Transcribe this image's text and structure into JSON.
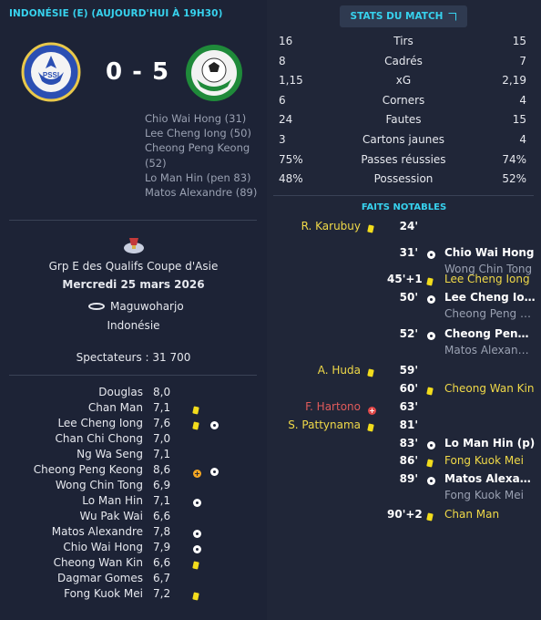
{
  "header": {
    "title": "INDONÉSIE (E) (AUJOURD'HUI À 19H30)"
  },
  "match": {
    "score": "0 - 5",
    "scorers": [
      "Chio Wai Hong (31)",
      "Lee Cheng Iong (50)",
      "Cheong Peng Keong (52)",
      "Lo Man Hin (pen 83)",
      "Matos Alexandre (89)"
    ],
    "competition": "Grp E des Qualifs Coupe d'Asie",
    "date": "Mercredi 25 mars 2026",
    "venue": "Maguwoharjo",
    "country": "Indonésie",
    "attendance": "Spectateurs : 31 700"
  },
  "crests": {
    "home_text": "PSSI",
    "away_text": ""
  },
  "ratings": [
    {
      "name": "Douglas",
      "rating": "8,0",
      "icons": []
    },
    {
      "name": "Chan Man",
      "rating": "7,1",
      "icons": [
        "yellow-card"
      ]
    },
    {
      "name": "Lee Cheng Iong",
      "rating": "7,6",
      "icons": [
        "yellow-card",
        "goal"
      ]
    },
    {
      "name": "Chan Chi Chong",
      "rating": "7,0",
      "icons": []
    },
    {
      "name": "Ng Wa Seng",
      "rating": "7,1",
      "icons": []
    },
    {
      "name": "Cheong Peng Keong",
      "rating": "8,6",
      "icons": [
        "sub",
        "goal"
      ]
    },
    {
      "name": "Wong Chin Tong",
      "rating": "6,9",
      "icons": []
    },
    {
      "name": "Lo Man Hin",
      "rating": "7,1",
      "icons": [
        "goal"
      ]
    },
    {
      "name": "Wu Pak Wai",
      "rating": "6,6",
      "icons": []
    },
    {
      "name": "Matos Alexandre",
      "rating": "7,8",
      "icons": [
        "goal"
      ]
    },
    {
      "name": "Chio Wai Hong",
      "rating": "7,9",
      "icons": [
        "goal"
      ]
    },
    {
      "name": "Cheong Wan Kin",
      "rating": "6,6",
      "icons": [
        "yellow-card"
      ]
    },
    {
      "name": "Dagmar Gomes",
      "rating": "6,7",
      "icons": []
    },
    {
      "name": "Fong Kuok Mei",
      "rating": "7,2",
      "icons": [
        "yellow-card"
      ]
    }
  ],
  "stats_button": "STATS DU MATCH",
  "stats": [
    {
      "home": "16",
      "name": "Tirs",
      "away": "15"
    },
    {
      "home": "8",
      "name": "Cadrés",
      "away": "7"
    },
    {
      "home": "1,15",
      "name": "xG",
      "away": "2,19"
    },
    {
      "home": "6",
      "name": "Corners",
      "away": "4"
    },
    {
      "home": "24",
      "name": "Fautes",
      "away": "15"
    },
    {
      "home": "3",
      "name": "Cartons jaunes",
      "away": "4"
    },
    {
      "home": "75%",
      "name": "Passes réussies",
      "away": "74%"
    },
    {
      "home": "48%",
      "name": "Possession",
      "away": "52%"
    }
  ],
  "faits_title": "FAITS NOTABLES",
  "events": [
    {
      "min": "24'",
      "home": "R. Karubuy",
      "home_icon": "yellow-card"
    },
    {
      "min": "31'",
      "away": "Chio Wai Hong",
      "away_sub": "Wong Chin Tong",
      "away_icon": "goal"
    },
    {
      "min": "45'+1",
      "away": "Lee Cheng Iong",
      "away_icon": "yellow-card",
      "away_yellow": true
    },
    {
      "min": "50'",
      "away": "Lee Cheng Iong",
      "away_sub": "Cheong Peng Keong",
      "away_icon": "goal"
    },
    {
      "min": "52'",
      "away": "Cheong Peng Keong",
      "away_sub": "Matos Alexandre",
      "away_icon": "goal"
    },
    {
      "min": "59'",
      "home": "A. Huda",
      "home_icon": "yellow-card"
    },
    {
      "min": "60'",
      "away": "Cheong Wan Kin",
      "away_icon": "yellow-card",
      "away_yellow": true
    },
    {
      "min": "63'",
      "home": "F. Hartono",
      "home_icon": "red-sub",
      "home_red": true
    },
    {
      "min": "81'",
      "home": "S. Pattynama",
      "home_icon": "yellow-card"
    },
    {
      "min": "83'",
      "away": "Lo Man Hin (p)",
      "away_icon": "goal"
    },
    {
      "min": "86'",
      "away": "Fong Kuok Mei",
      "away_icon": "yellow-card",
      "away_yellow": true
    },
    {
      "min": "89'",
      "away": "Matos Alexandre",
      "away_sub": "Fong Kuok Mei",
      "away_icon": "goal"
    },
    {
      "min": "90'+2",
      "away": "Chan Man",
      "away_icon": "yellow-card",
      "away_yellow": true
    }
  ],
  "colors": {
    "accent": "#37d2ee",
    "yellow": "#f2dc1c",
    "bg": "#1e2537"
  }
}
